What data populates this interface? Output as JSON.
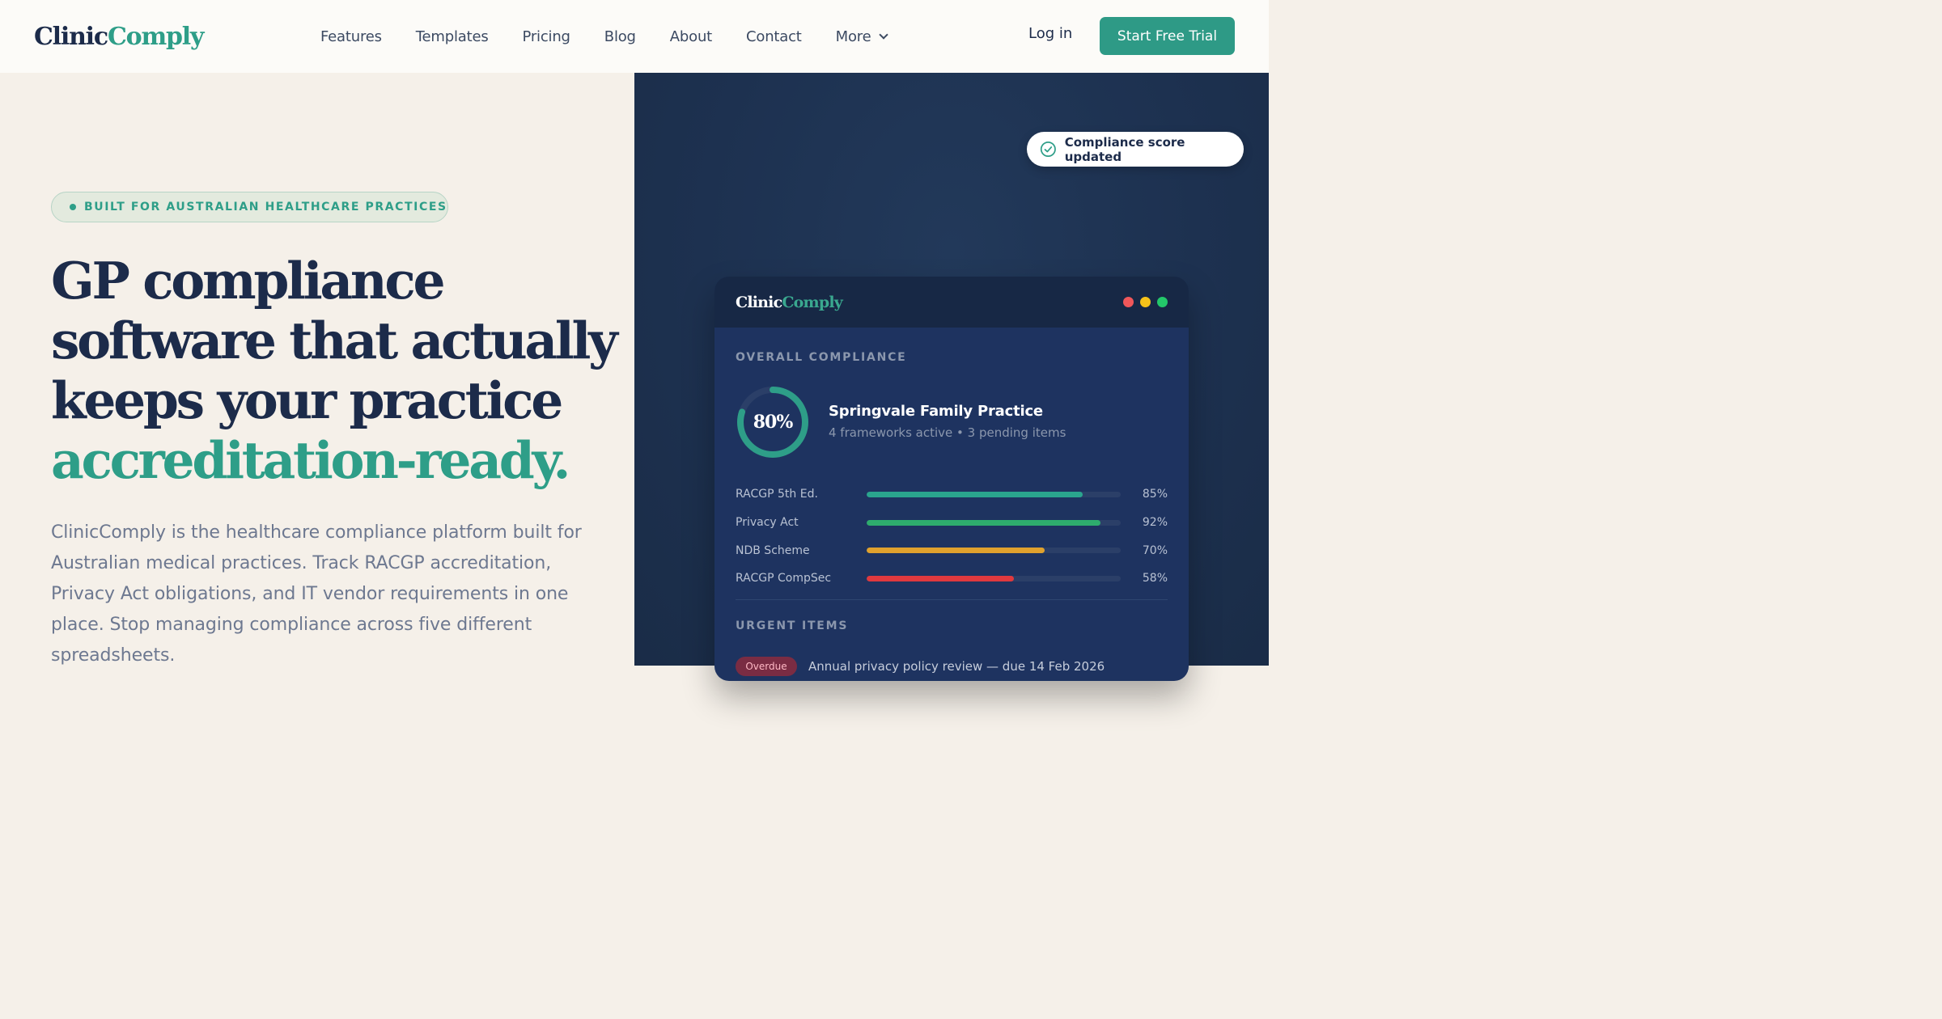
{
  "nav": {
    "logo_part1": "Clinic",
    "logo_part2": "Comply",
    "links": [
      "Features",
      "Templates",
      "Pricing",
      "Blog",
      "About",
      "Contact",
      "More"
    ],
    "login": "Log in",
    "cta": "Start Free Trial"
  },
  "hero": {
    "badge": "BUILT FOR AUSTRALIAN HEALTHCARE PRACTICES",
    "headline_lines": [
      "GP compliance",
      "software that actually",
      "keeps your practice"
    ],
    "headline_accent": "accreditation-ready.",
    "description": "ClinicComply is the healthcare compliance platform built for Australian medical practices. Track RACGP accreditation, Privacy Act obligations, and IT vendor requirements in one place. Stop managing compliance across five different spreadsheets."
  },
  "toast": {
    "icon": "check-circle-icon",
    "text": "Compliance score updated"
  },
  "dashboard": {
    "logo_part1": "Clinic",
    "logo_part2": "Comply",
    "window_dots": [
      "#f0575a",
      "#f5c21a",
      "#23c86a"
    ],
    "overall_label": "OVERALL COMPLIANCE",
    "overall_value": 0.8,
    "overall_text": "80%",
    "practice_name": "Springvale Family Practice",
    "practice_sub": "4 frameworks active • 3 pending items",
    "frameworks": [
      {
        "name": "RACGP 5th Ed.",
        "value": 0.85,
        "pct": "85%",
        "color": "#2aa58e"
      },
      {
        "name": "Privacy Act",
        "value": 0.92,
        "pct": "92%",
        "color": "#2eac6d"
      },
      {
        "name": "NDB Scheme",
        "value": 0.7,
        "pct": "70%",
        "color": "#e0a22e"
      },
      {
        "name": "RACGP CompSec",
        "value": 0.58,
        "pct": "58%",
        "color": "#e0393e"
      }
    ],
    "urgent_label": "URGENT ITEMS",
    "urgent_item": {
      "tag": "Overdue",
      "text": "Annual privacy policy review — due 14 Feb 2026"
    }
  },
  "colors": {
    "brand_navy": "#1c2b4a",
    "brand_teal": "#2e9e88",
    "hero_bg": "#f5f0e9",
    "panel_bg": "#1d3150"
  }
}
